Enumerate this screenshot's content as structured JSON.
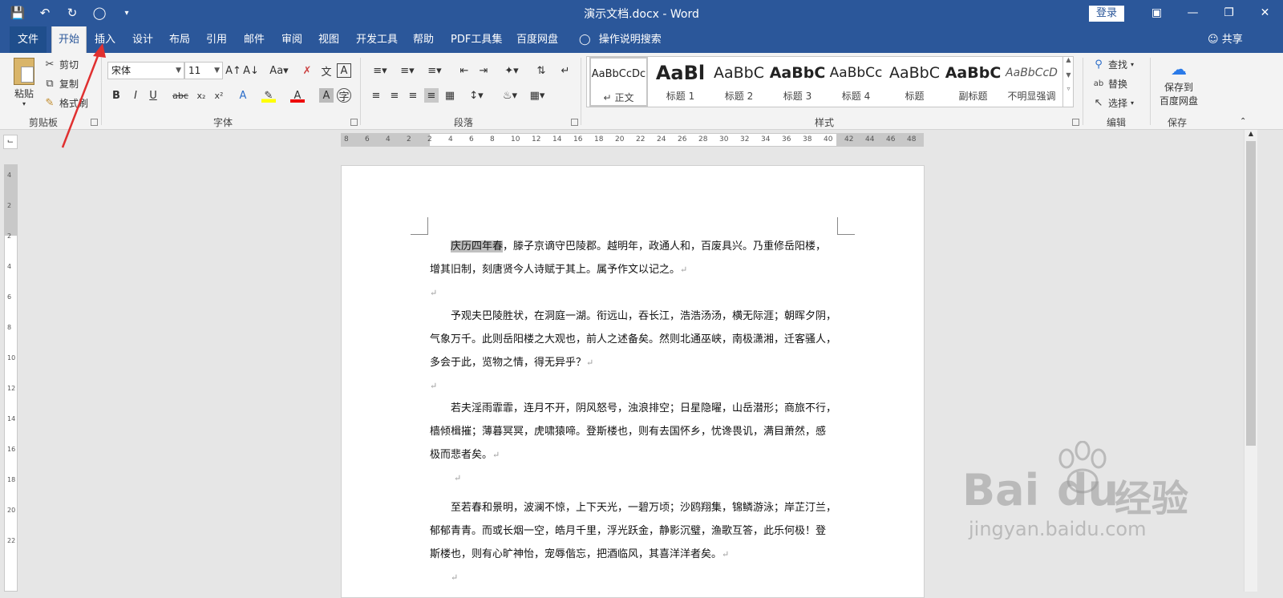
{
  "window": {
    "title": "演示文档.docx  -  Word",
    "login": "登录"
  },
  "tabs": [
    {
      "label": "文件"
    },
    {
      "label": "开始"
    },
    {
      "label": "插入"
    },
    {
      "label": "设计"
    },
    {
      "label": "布局"
    },
    {
      "label": "引用"
    },
    {
      "label": "邮件"
    },
    {
      "label": "审阅"
    },
    {
      "label": "视图"
    },
    {
      "label": "开发工具"
    },
    {
      "label": "帮助"
    },
    {
      "label": "PDF工具集"
    },
    {
      "label": "百度网盘"
    }
  ],
  "tell_me": "操作说明搜索",
  "share": "共享",
  "clipboard": {
    "paste": "粘贴",
    "cut": "剪切",
    "copy": "复制",
    "format_painter": "格式刷",
    "group": "剪贴板"
  },
  "font": {
    "name": "宋体",
    "size": "11",
    "group": "字体"
  },
  "paragraph": {
    "group": "段落"
  },
  "styles": {
    "group": "样式",
    "items": [
      {
        "preview": "AaBbCcDc",
        "name": "正文"
      },
      {
        "preview": "AaBl",
        "name": "标题 1"
      },
      {
        "preview": "AaBbC",
        "name": "标题 2"
      },
      {
        "preview": "AaBbC",
        "name": "标题 3"
      },
      {
        "preview": "AaBbCc",
        "name": "标题 4"
      },
      {
        "preview": "AaBbC",
        "name": "标题"
      },
      {
        "preview": "AaBbC",
        "name": "副标题"
      },
      {
        "preview": "AaBbCcD",
        "name": "不明显强调"
      }
    ]
  },
  "editing": {
    "find": "查找",
    "replace": "替换",
    "select": "选择",
    "group": "编辑"
  },
  "save": {
    "button": "保存到百度网盘",
    "line1": "保存到",
    "line2": "百度网盘",
    "group": "保存"
  },
  "ruler": {
    "h_ticks": [
      "8",
      "6",
      "4",
      "2",
      "2",
      "4",
      "6",
      "8",
      "10",
      "12",
      "14",
      "16",
      "18",
      "20",
      "22",
      "24",
      "26",
      "28",
      "30",
      "32",
      "34",
      "36",
      "38",
      "40",
      "42",
      "44",
      "46",
      "48"
    ],
    "v_ticks": [
      "4",
      "2",
      "2",
      "4",
      "6",
      "8",
      "10",
      "12",
      "14",
      "16",
      "18",
      "20",
      "22"
    ]
  },
  "document": {
    "p1": {
      "highlight": "庆历四年春",
      "line1_rest": "，滕子京谪守巴陵郡。越明年，政通人和，百废具兴。乃重修岳阳楼，",
      "line2": "增其旧制，刻唐贤今人诗赋于其上。属予作文以记之。"
    },
    "p2": [
      "予观夫巴陵胜状，在洞庭一湖。衔远山，吞长江，浩浩汤汤，横无际涯；朝晖夕阴，",
      "气象万千。此则岳阳楼之大观也，前人之述备矣。然则北通巫峡，南极潇湘，迁客骚人，",
      "多会于此，览物之情，得无异乎？"
    ],
    "p3": [
      "若夫淫雨霏霏，连月不开，阴风怒号，浊浪排空；日星隐曜，山岳潜形；商旅不行，",
      "樯倾楫摧；薄暮冥冥，虎啸猿啼。登斯楼也，则有去国怀乡，忧谗畏讥，满目萧然，感",
      "极而悲者矣。"
    ],
    "p4": [
      "至若春和景明，波澜不惊，上下天光，一碧万顷；沙鸥翔集，锦鳞游泳；岸芷汀兰，",
      "郁郁青青。而或长烟一空，皓月千里，浮光跃金，静影沉璧，渔歌互答，此乐何极！登",
      "斯楼也，则有心旷神怡，宠辱偕忘，把酒临风，其喜洋洋者矣。"
    ],
    "para_mark": "↵"
  },
  "watermark": {
    "brand": "Bai",
    "brand2": "du",
    "cn": "经验",
    "url": "jingyan.baidu.com"
  },
  "colors": {
    "word_blue": "#2b579a",
    "annotation_red": "#e03030"
  }
}
